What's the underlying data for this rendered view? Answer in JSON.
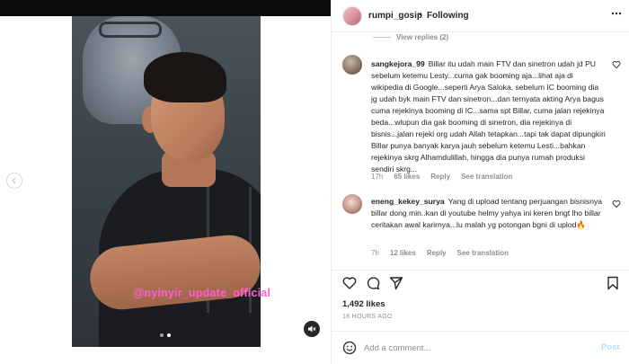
{
  "post": {
    "username": "rumpi_gosip",
    "separator": "•",
    "follow_status": "Following",
    "more_icon": "more-horizontal-icon"
  },
  "media": {
    "watermark": "@nyinyir_update_official",
    "carousel_index": 2,
    "carousel_count": 2,
    "muted": true
  },
  "comments": {
    "view_replies": "View replies (2)",
    "items": [
      {
        "username": "sangkejora_99",
        "text": "Billar itu udah main FTV dan sinetron udah jd PU sebelum ketemu Lesty...cuma gak booming aja...lihat aja di wikipedia di Google...seperti Arya Saloka, sebelum IC booming dia jg udah byk main FTV dan sinetron...dan ternyata akting Arya bagus cuma rejekinya booming di IC...sama spt Billar, cuma jalan rejekinya beda...wlupun dia gak booming di sinetron, dia rejekinya di bisnis...jalan rejeki org udah Allah tetapkan...tapi tak dapat dipungkiri Billar punya banyak karya jauh sebelum ketemu Lesti...bahkan rejekinya skrg Alhamdulillah, hingga dia punya rumah produksi sendiri skrg...",
        "time": "17h",
        "likes": "65 likes",
        "reply": "Reply",
        "translation": "See translation"
      },
      {
        "username": "eneng_kekey_surya",
        "text": "Yang di upload tentang perjuangan bisnisnya billar dong min..kan di youtube helmy yahya ini keren bngt lho billar ceritakan awal karirnya...lu malah yg potongan bgni di uplod🔥",
        "time": "7h",
        "likes": "12 likes",
        "reply": "Reply",
        "translation": "See translation"
      }
    ]
  },
  "actions": {
    "like_icon": "heart-icon",
    "comment_icon": "comment-icon",
    "share_icon": "send-icon",
    "save_icon": "bookmark-icon"
  },
  "stats": {
    "likes": "1,492 likes",
    "time_ago": "18 HOURS AGO"
  },
  "composer": {
    "emoji_icon": "emoji-icon",
    "placeholder": "Add a comment...",
    "post_label": "Post"
  },
  "colors": {
    "text": "#262626",
    "muted": "#8e8e8e",
    "post_disabled": "#b2dffc",
    "watermark": "#ff5fd2"
  }
}
